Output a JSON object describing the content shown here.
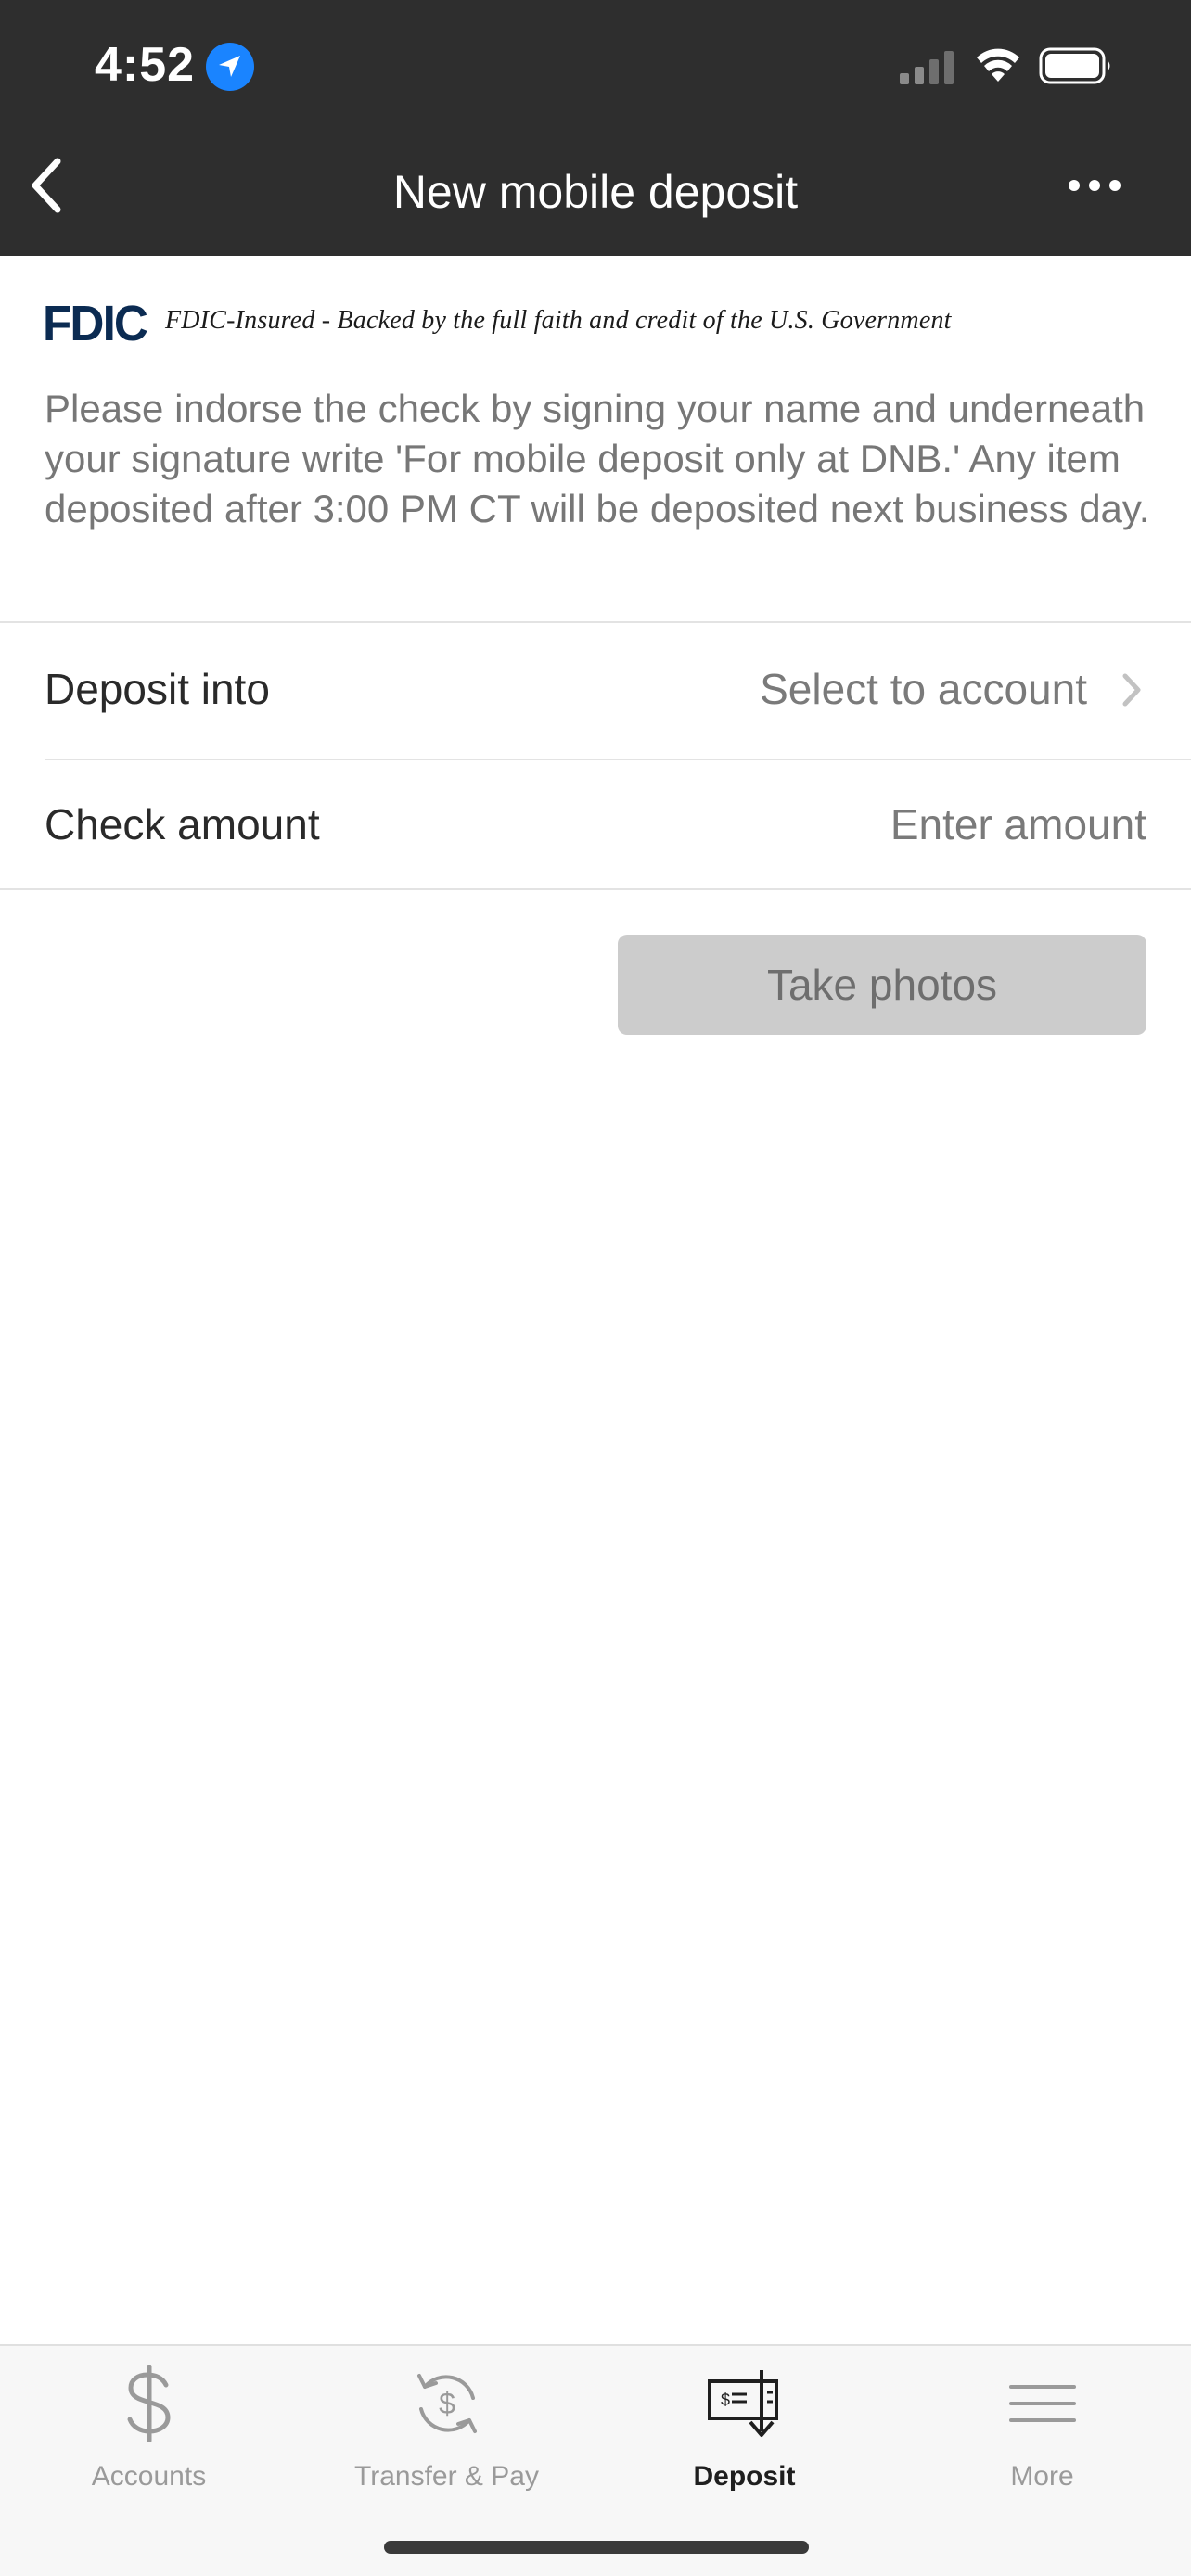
{
  "status_bar": {
    "time": "4:52",
    "location_icon": "location-arrow-icon",
    "signal_icon": "cellular-signal-icon",
    "wifi_icon": "wifi-icon",
    "battery_icon": "battery-icon"
  },
  "nav": {
    "title": "New mobile deposit",
    "back_icon": "chevron-left-icon",
    "more_icon": "more-horizontal-icon"
  },
  "fdic": {
    "logo_text": "FDIC",
    "notice": "FDIC-Insured - Backed by the full faith and credit of the U.S. Government"
  },
  "instructions": "Please indorse the check by signing your name and underneath your signature write 'For mobile deposit only at DNB.' Any item deposited after 3:00 PM CT will be deposited next business day.",
  "form": {
    "deposit_into": {
      "label": "Deposit into",
      "value": "Select to account"
    },
    "check_amount": {
      "label": "Check amount",
      "placeholder": "Enter amount"
    },
    "take_photos_label": "Take photos"
  },
  "tabs": [
    {
      "label": "Accounts",
      "icon": "dollar-icon",
      "active": false
    },
    {
      "label": "Transfer & Pay",
      "icon": "transfer-dollar-icon",
      "active": false
    },
    {
      "label": "Deposit",
      "icon": "check-deposit-icon",
      "active": true
    },
    {
      "label": "More",
      "icon": "menu-icon",
      "active": false
    }
  ],
  "colors": {
    "header_bg": "#2e2e2e",
    "fdic_blue": "#0b2b52",
    "location_blue": "#1a84ff",
    "disabled_button": "#cccccc"
  }
}
